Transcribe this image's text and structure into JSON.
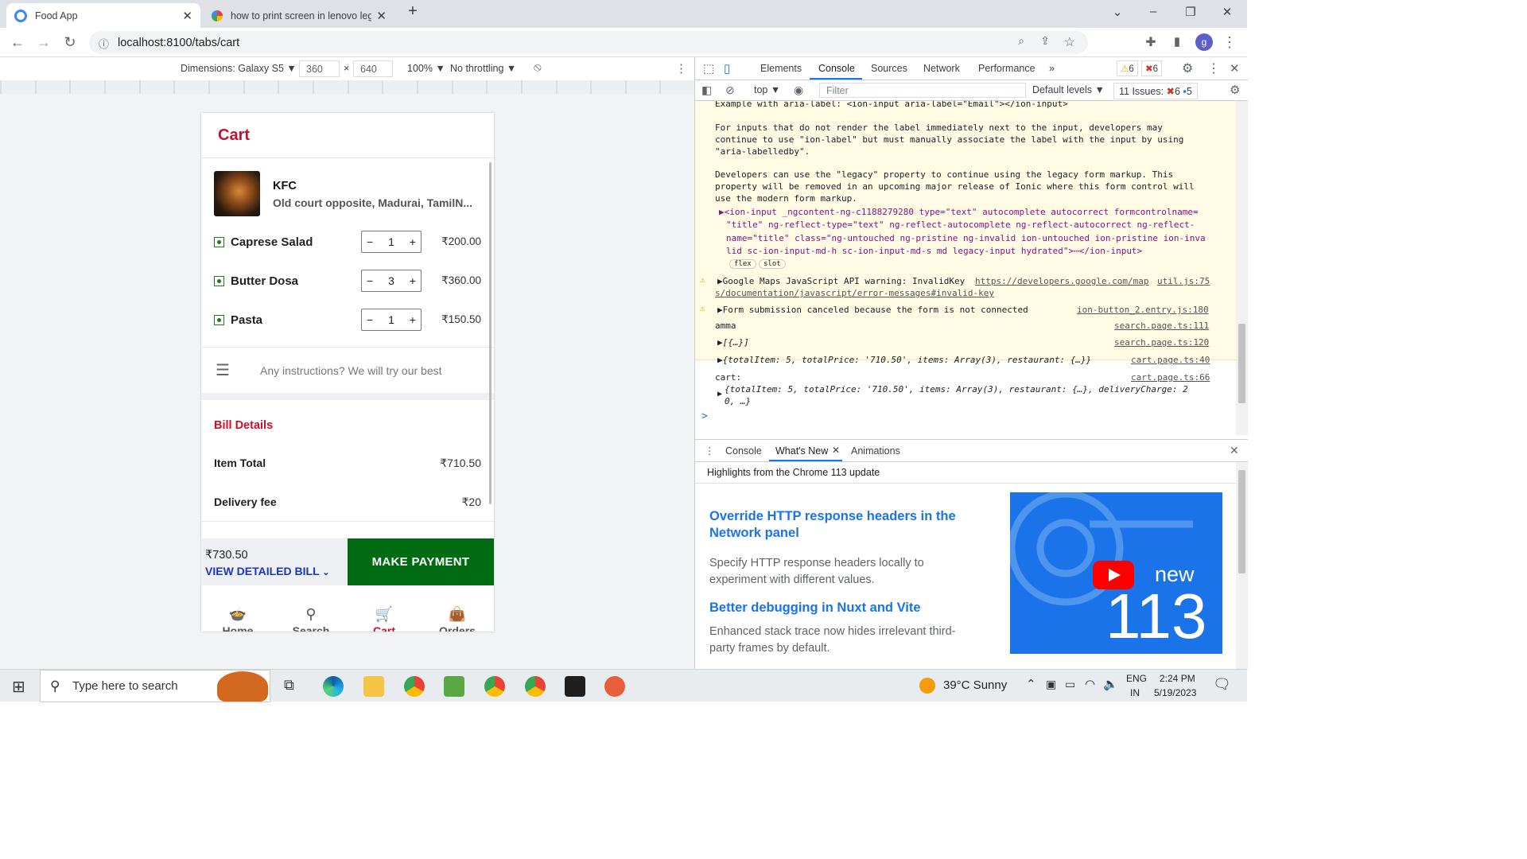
{
  "browser": {
    "tabs": [
      {
        "title": "Food App",
        "active": true
      },
      {
        "title": "how to print screen in lenovo leg",
        "active": false
      }
    ],
    "url": "localhost:8100/tabs/cart",
    "profile_initial": "g"
  },
  "device_toolbar": {
    "dimensions_label": "Dimensions: Galaxy S5 ▼",
    "width": "360",
    "height": "640",
    "zoom": "100% ▼",
    "throttling": "No throttling ▼"
  },
  "app": {
    "page_title": "Cart",
    "restaurant": {
      "name": "KFC",
      "address": "Old court opposite, Madurai, TamilN..."
    },
    "items": [
      {
        "name": "Caprese Salad",
        "qty": "1",
        "price": "₹200.00"
      },
      {
        "name": "Butter Dosa",
        "qty": "3",
        "price": "₹360.00"
      },
      {
        "name": "Pasta",
        "qty": "1",
        "price": "₹150.50"
      }
    ],
    "instructions_placeholder": "Any instructions? We will try our best",
    "bill": {
      "heading": "Bill Details",
      "item_total_label": "Item Total",
      "item_total": "₹710.50",
      "delivery_label": "Delivery fee",
      "delivery": "₹20"
    },
    "footer": {
      "total": "₹730.50",
      "view_bill": "VIEW DETAILED BILL",
      "pay_button": "MAKE PAYMENT"
    },
    "nav": [
      {
        "label": "Home",
        "icon": "bowl-icon"
      },
      {
        "label": "Search",
        "icon": "search-icon"
      },
      {
        "label": "Cart",
        "icon": "cart-icon"
      },
      {
        "label": "Orders",
        "icon": "bag-icon"
      }
    ],
    "colors": {
      "accent": "#c8102e",
      "pay_button": "#006b12",
      "veg": "#1e7b1e"
    }
  },
  "devtools": {
    "tabs": [
      "Elements",
      "Console",
      "Sources",
      "Network",
      "Performance"
    ],
    "active_tab": "Console",
    "warn_count": "6",
    "error_count": "6",
    "context": "top ▼",
    "filter_placeholder": "Filter",
    "levels": "Default levels ▼",
    "issues_label": "11 Issues:",
    "issues_errors": "6",
    "issues_info": "5",
    "log": {
      "l1": "Example with aria-label: <ion-input aria-label=\"Email\"></ion-input>",
      "l2": "For inputs that do not render the label immediately next to the input, developers may",
      "l3": "continue to use \"ion-label\" but must manually associate the label with the input by using",
      "l4": "\"aria-labelledby\".",
      "l5": "Developers can use the \"legacy\" property to continue using the legacy form markup. This",
      "l6": "property will be removed in an upcoming major release of Ionic where this form control will",
      "l7": "use the modern form markup.",
      "l8": "▶<ion-input _ngcontent-ng-c1188279280 type=\"text\" autocomplete autocorrect formcontrolname=",
      "l9": "\"title\" ng-reflect-type=\"text\" ng-reflect-autocomplete ng-reflect-autocorrect ng-reflect-",
      "l10": "name=\"title\" class=\"ng-untouched ng-pristine ng-invalid ion-untouched ion-pristine ion-inva",
      "l11": "lid sc-ion-input-md-h sc-ion-input-md-s md legacy-input hydrated\">⋯</ion-input>",
      "badge_flex": "flex",
      "badge_slot": "slot",
      "gmaps": "▶Google Maps JavaScript API warning: InvalidKey",
      "gmaps_link": "https://developers.google.com/map",
      "gmaps_src": "util.js:75",
      "gmaps_link2": "s/documentation/javascript/error-messages#invalid-key",
      "form": "▶Form submission canceled because the form is not connected",
      "form_src": "ion-button_2.entry.js:180",
      "amma": "amma",
      "amma_src": "search.page.ts:111",
      "arr": "▶[{…}]",
      "arr_src": "search.page.ts:120",
      "obj1": "▶{totalItem: 5, totalPrice: '710.50', items: Array(3), restaurant: {…}}",
      "obj1_src": "cart.page.ts:40",
      "cart": "cart:",
      "cart_src": "cart.page.ts:66",
      "obj2a": "{totalItem: 5, totalPrice: '710.50', items: Array(3), restaurant: {…}, deliveryCharge: 2",
      "obj2b": "0, …}",
      "prompt": ">"
    },
    "drawer": {
      "tabs": [
        "Console",
        "What's New",
        "Animations"
      ],
      "active": "What's New",
      "highlights": "Highlights from the Chrome 113 update",
      "h1": "Override HTTP response headers in the Network panel",
      "p1": "Specify HTTP response headers locally to experiment with different values.",
      "h2": "Better debugging in Nuxt and Vite",
      "p2": "Enhanced stack trace now hides irrelevant third-party frames by default.",
      "video_new": "new",
      "video_ver": "113"
    }
  },
  "taskbar": {
    "search_placeholder": "Type here to search",
    "weather": "39°C  Sunny",
    "lang1": "ENG",
    "lang2": "IN",
    "time": "2:24 PM",
    "date": "5/19/2023"
  }
}
